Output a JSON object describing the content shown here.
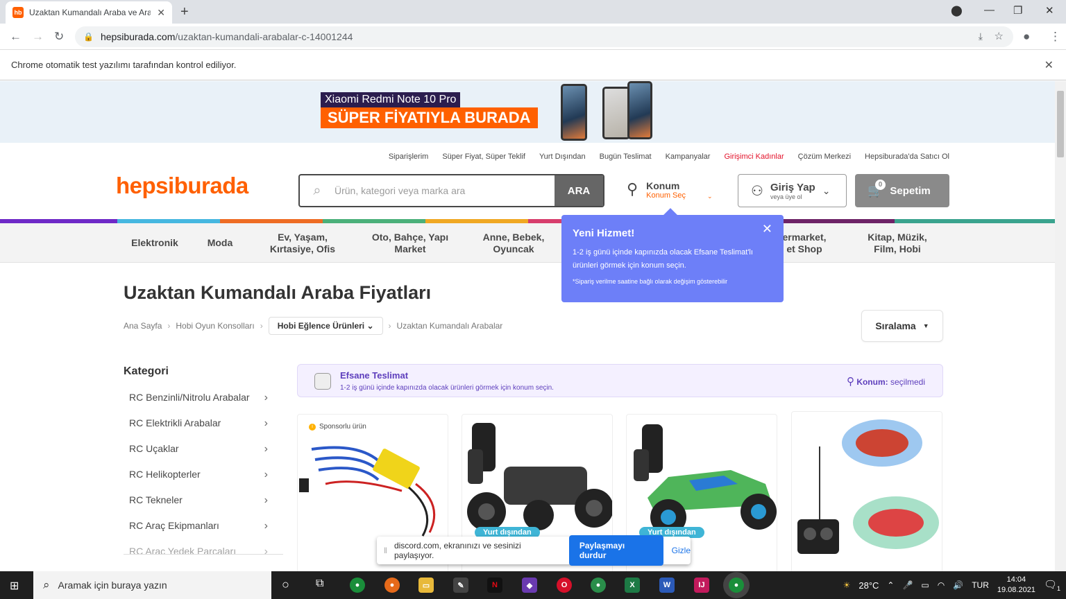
{
  "browser": {
    "tab_title": "Uzaktan Kumandalı Araba ve Ara",
    "tab_favicon": "hb",
    "url_host": "hepsiburada.com",
    "url_path": "/uzaktan-kumandali-arabalar-c-14001244",
    "infobar_text": "Chrome otomatik test yazılımı tarafından kontrol ediliyor."
  },
  "banner": {
    "line1": "Xiaomi Redmi Note 10 Pro",
    "line2": "SÜPER FİYATIYLA BURADA"
  },
  "top_links": [
    "Siparişlerim",
    "Süper Fiyat, Süper Teklif",
    "Yurt Dışından",
    "Bugün Teslimat",
    "Kampanyalar",
    "Girişimci Kadınlar",
    "Çözüm Merkezi",
    "Hepsiburada'da Satıcı Ol"
  ],
  "header": {
    "logo": "hepsiburada",
    "search_placeholder": "Ürün, kategori veya marka ara",
    "search_button": "ARA",
    "location_title": "Konum",
    "location_sub": "Konum Seç",
    "login_title": "Giriş Yap",
    "login_sub": "veya üye ol",
    "cart_label": "Sepetim",
    "cart_count": "0"
  },
  "colors": {
    "brand": "#ff6000",
    "popup": "#6d7ff8",
    "efsane": "#5d3ebc"
  },
  "categories": [
    "Elektronik",
    "Moda",
    "Ev, Yaşam, Kırtasiye, Ofis",
    "Oto, Bahçe, Yapı Market",
    "Anne, Bebek, Oyuncak",
    "ermarket, et Shop",
    "Kitap, Müzik, Film, Hobi"
  ],
  "popup": {
    "title": "Yeni Hizmet!",
    "body": "1-2 iş günü içinde kapınızda olacak Efsane Teslimat'lı ürünleri görmek için konum seçin.",
    "note": "*Sipariş verilme saatine bağlı olarak değişim gösterebilir"
  },
  "page": {
    "title": "Uzaktan Kumandalı Araba Fiyatları",
    "breadcrumb": [
      "Ana Sayfa",
      "Hobi Oyun Konsolları",
      "Hobi Eğlence Ürünleri",
      "Uzaktan Kumandalı Arabalar"
    ],
    "sort_label": "Sıralama"
  },
  "sidebar": {
    "heading": "Kategori",
    "items": [
      "RC Benzinli/Nitrolu Arabalar",
      "RC Elektrikli Arabalar",
      "RC Uçaklar",
      "RC Helikopterler",
      "RC Tekneler",
      "RC Araç Ekipmanları",
      "RC Araç Yedek Parçaları"
    ]
  },
  "efsane": {
    "title": "Efsane Teslimat",
    "desc": "1-2 iş günü içinde kapınızda olacak ürünleri görmek için konum seçin.",
    "loc_label": "Konum:",
    "loc_value": "seçilmedi"
  },
  "products": {
    "sponsored_label": "Sponsorlu ürün",
    "abroad_label": "Yurt dışından"
  },
  "share_bar": {
    "text": "discord.com, ekranınızı ve sesinizi paylaşıyor.",
    "stop": "Paylaşmayı durdur",
    "hide": "Gizle"
  },
  "taskbar": {
    "search_placeholder": "Aramak için buraya yazın",
    "weather": "28°C",
    "lang": "TUR",
    "time": "14:04",
    "date": "19.08.2021",
    "notif_count": "1"
  }
}
